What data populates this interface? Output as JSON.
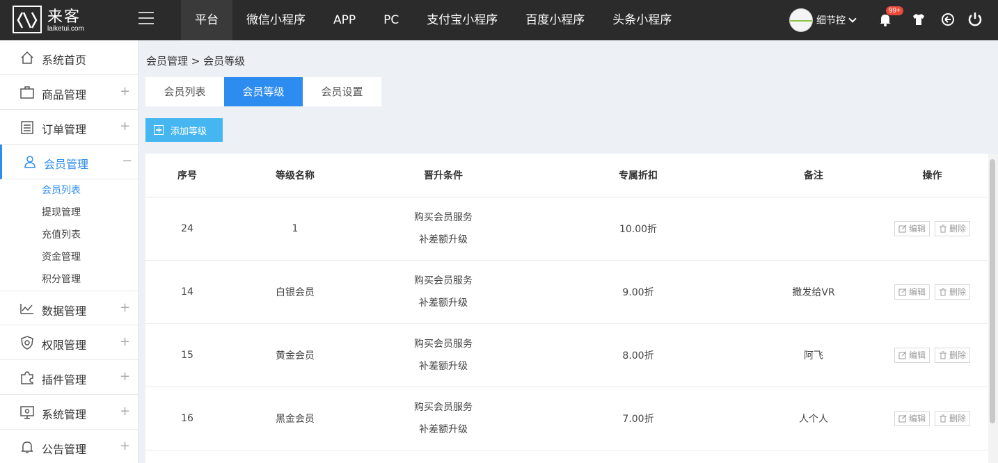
{
  "logo": {
    "title": "来客",
    "sub": "laiketui.com"
  },
  "nav": [
    "平台",
    "微信小程序",
    "APP",
    "PC",
    "支付宝小程序",
    "百度小程序",
    "头条小程序"
  ],
  "user": {
    "name": "细节控"
  },
  "notifications": {
    "badge": "99+"
  },
  "sidebar": {
    "items": [
      {
        "label": "系统首页",
        "icon": "home-icon"
      },
      {
        "label": "商品管理",
        "icon": "bag-icon"
      },
      {
        "label": "订单管理",
        "icon": "order-icon"
      },
      {
        "label": "会员管理",
        "icon": "member-icon"
      },
      {
        "label": "数据管理",
        "icon": "chart-icon"
      },
      {
        "label": "权限管理",
        "icon": "shield-icon"
      },
      {
        "label": "插件管理",
        "icon": "puzzle-icon"
      },
      {
        "label": "系统管理",
        "icon": "monitor-icon"
      },
      {
        "label": "公告管理",
        "icon": "bell-icon"
      }
    ],
    "sub": [
      "会员列表",
      "提现管理",
      "充值列表",
      "资金管理",
      "积分管理"
    ]
  },
  "breadcrumb": "会员管理 > 会员等级",
  "tabs": [
    "会员列表",
    "会员等级",
    "会员设置"
  ],
  "add_button": "添加等级",
  "table": {
    "headers": [
      "序号",
      "等级名称",
      "晋升条件",
      "专属折扣",
      "备注",
      "操作"
    ],
    "rows": [
      {
        "id": "24",
        "name": "1",
        "cond1": "购买会员服务",
        "cond2": "补差额升级",
        "discount": "10.00折",
        "note": ""
      },
      {
        "id": "14",
        "name": "白银会员",
        "cond1": "购买会员服务",
        "cond2": "补差额升级",
        "discount": "9.00折",
        "note": "撒发给VR"
      },
      {
        "id": "15",
        "name": "黄金会员",
        "cond1": "购买会员服务",
        "cond2": "补差额升级",
        "discount": "8.00折",
        "note": "阿飞"
      },
      {
        "id": "16",
        "name": "黑金会员",
        "cond1": "购买会员服务",
        "cond2": "补差额升级",
        "discount": "7.00折",
        "note": "人个人"
      }
    ],
    "edit_label": "编辑",
    "delete_label": "删除"
  },
  "colors": {
    "accent": "#2d8cf0",
    "topbar": "#2b2b2b",
    "add_button": "#46b6f1"
  }
}
